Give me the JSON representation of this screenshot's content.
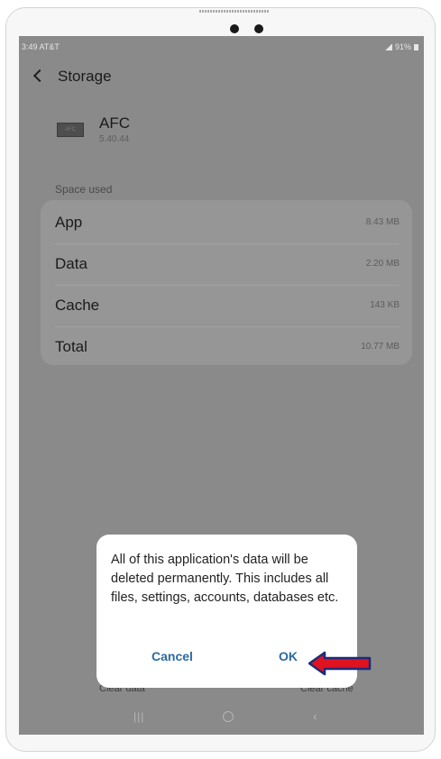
{
  "status_bar": {
    "time_carrier": "3:49 AT&T",
    "battery": "91%"
  },
  "header": {
    "title": "Storage"
  },
  "app": {
    "icon_label": "AFC",
    "name": "AFC",
    "version": "5.40.44"
  },
  "space_used": {
    "label": "Space used",
    "rows": [
      {
        "label": "App",
        "value": "8.43 MB"
      },
      {
        "label": "Data",
        "value": "2.20 MB"
      },
      {
        "label": "Cache",
        "value": "143 KB"
      },
      {
        "label": "Total",
        "value": "10.77 MB"
      }
    ]
  },
  "bottom_actions": {
    "clear_data": "Clear data",
    "clear_cache": "Clear cache"
  },
  "dialog": {
    "message": "All of this application's data will be deleted permanently. This includes all files, settings, accounts, databases etc.",
    "cancel_label": "Cancel",
    "ok_label": "OK"
  },
  "nav_bar": {
    "recent_glyph": "|||",
    "back_glyph": "‹"
  },
  "colors": {
    "dim_overlay": "#8a8a8a",
    "accent": "#2a6aa1",
    "arrow": "#e0121f"
  },
  "icons": [
    "back-icon",
    "app-icon",
    "signal-icon",
    "battery-icon",
    "recent-apps-icon",
    "home-icon",
    "nav-back-icon",
    "red-arrow-icon"
  ]
}
